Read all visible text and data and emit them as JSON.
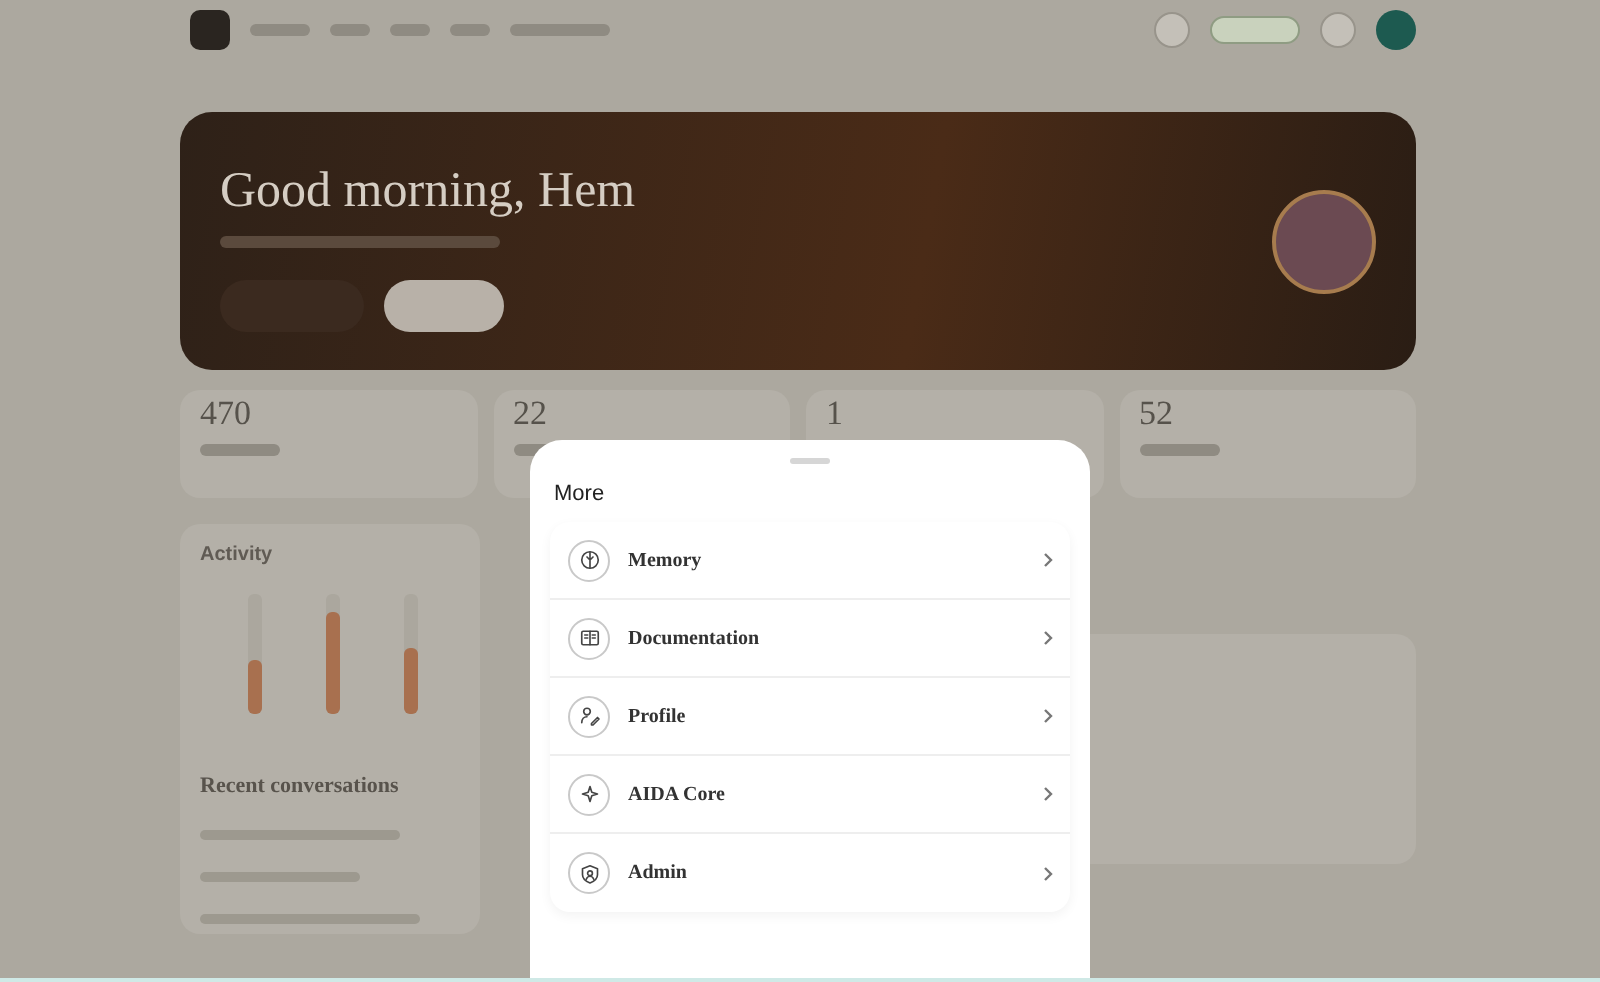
{
  "dashboard": {
    "greeting": "Good morning, Hem",
    "stats": [
      {
        "value": "470"
      },
      {
        "value": "22"
      },
      {
        "value": "1"
      },
      {
        "value": "52"
      }
    ],
    "activity": {
      "title": "Activity",
      "bars": [
        {
          "level": 0.45
        },
        {
          "level": 0.85
        },
        {
          "level": 0.55
        }
      ]
    },
    "recent": {
      "title": "Recent conversations"
    }
  },
  "sheet": {
    "title": "More",
    "items": [
      {
        "label": "Memory",
        "kind": "memory"
      },
      {
        "label": "Documentation",
        "kind": "docs"
      },
      {
        "label": "Profile",
        "kind": "profile"
      },
      {
        "label": "AIDA Core",
        "kind": "core"
      },
      {
        "label": "Admin",
        "kind": "admin"
      }
    ]
  }
}
